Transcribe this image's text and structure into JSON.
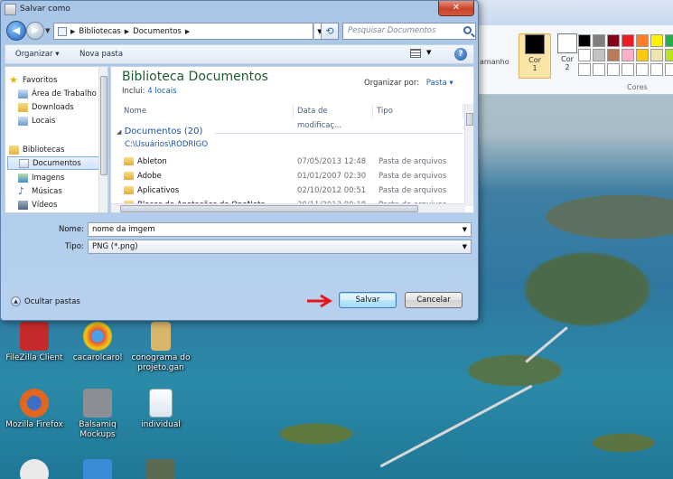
{
  "dialog": {
    "title": "Salvar como",
    "close_label": "✕"
  },
  "address": {
    "breadcrumbs": [
      "Bibliotecas",
      "Documentos"
    ],
    "search_placeholder": "Pesquisar Documentos"
  },
  "toolbar": {
    "organize_label": "Organizar ▾",
    "new_folder_label": "Nova pasta"
  },
  "nav": {
    "items": [
      {
        "label": "Favoritos",
        "icon": "star-icon"
      },
      {
        "label": "Área de Trabalho",
        "icon": "desktop-icon"
      },
      {
        "label": "Downloads",
        "icon": "downloads-icon"
      },
      {
        "label": "Locais",
        "icon": "recent-places-icon"
      },
      {
        "label": "Bibliotecas",
        "icon": "libraries-icon"
      },
      {
        "label": "Documentos",
        "icon": "documents-icon",
        "selected": true
      },
      {
        "label": "Imagens",
        "icon": "pictures-icon"
      },
      {
        "label": "Músicas",
        "icon": "music-icon"
      },
      {
        "label": "Vídeos",
        "icon": "videos-icon"
      }
    ]
  },
  "library": {
    "title": "Biblioteca Documentos",
    "includes_label": "Inclui:",
    "includes_link": "4 locais",
    "arrange_label": "Organizar por:",
    "arrange_value": "Pasta ▾"
  },
  "columns": [
    "Nome",
    "Data de modificaç...",
    "Tipo"
  ],
  "group": {
    "label": "Documentos (20)",
    "path": "C:\\Usuários\\RODRIGO"
  },
  "files": [
    {
      "name": "Ableton",
      "date": "07/05/2013 12:48",
      "type": "Pasta de arquivos"
    },
    {
      "name": "Adobe",
      "date": "01/01/2007 02:30",
      "type": "Pasta de arquivos"
    },
    {
      "name": "Aplicativos",
      "date": "02/10/2012 00:51",
      "type": "Pasta de arquivos"
    },
    {
      "name": "Blocos de Anotações do OneNote",
      "date": "20/11/2013 00:18",
      "type": "Pasta de arquivos"
    }
  ],
  "form": {
    "name_label": "Nome:",
    "name_value": "nome da imgem",
    "type_label": "Tipo:",
    "type_value": "PNG (*.png)"
  },
  "footer": {
    "hide_folders": "Ocultar pastas",
    "save": "Salvar",
    "cancel": "Cancelar"
  },
  "paint": {
    "size_label": "amanho",
    "color1": "Cor\n1",
    "color1_a": "Cor",
    "color1_b": "1",
    "color2_a": "Cor",
    "color2_b": "2",
    "colors_label": "Cores",
    "palette": [
      "#000000",
      "#7f7f7f",
      "#880015",
      "#ed1c24",
      "#ff7f27",
      "#fff200",
      "#22b14c",
      "#ffffff",
      "#c3c3c3",
      "#b97a57",
      "#ffaec9",
      "#ffc90e",
      "#efe4b0",
      "#b5e61d",
      "#ffffff",
      "#ffffff",
      "#ffffff",
      "#ffffff",
      "#ffffff",
      "#ffffff",
      "#ffffff"
    ]
  },
  "desktop_icons": [
    {
      "label": "FileZilla Client",
      "color": "#c62b2b"
    },
    {
      "label": "cacarolcarol",
      "color": "#3a8bd8"
    },
    {
      "label": "conograma do projeto.gan",
      "color": "#d9b66a"
    },
    {
      "label": "Mozilla Firefox",
      "color": "#e2661e"
    },
    {
      "label": "Balsamiq Mockups",
      "color": "#8a8f96"
    },
    {
      "label": "individual",
      "color": "#2b5fb0"
    }
  ]
}
